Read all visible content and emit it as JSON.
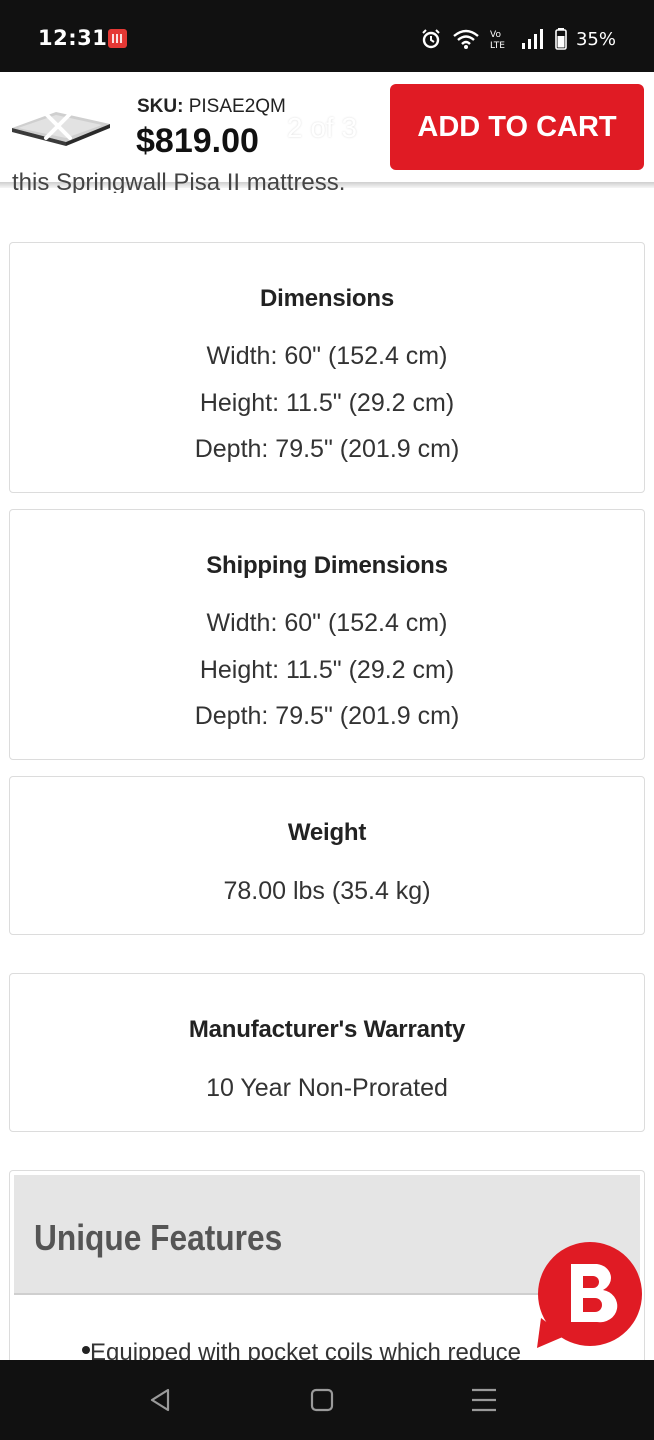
{
  "status_bar": {
    "time": "12:31",
    "battery": "35%",
    "icons": [
      "calendar-notification-icon",
      "alarm-icon",
      "wifi-icon",
      "volte-icon",
      "signal-icon",
      "battery-icon"
    ]
  },
  "sticky_header": {
    "sku_label": "SKU:",
    "sku_value": "PISAE2QM",
    "price": "$819.00",
    "pager": "2 of 3",
    "add_to_cart_label": "ADD TO CART",
    "accent_color": "#e01b24"
  },
  "partial_text": "this Springwall Pisa II mattress.",
  "specs": {
    "dimensions": {
      "title": "Dimensions",
      "lines": [
        "Width: 60\" (152.4 cm)",
        "Height: 11.5\" (29.2 cm)",
        "Depth: 79.5\" (201.9 cm)"
      ]
    },
    "shipping": {
      "title": "Shipping Dimensions",
      "lines": [
        "Width: 60\" (152.4 cm)",
        "Height: 11.5\" (29.2 cm)",
        "Depth: 79.5\" (201.9 cm)"
      ]
    },
    "weight": {
      "title": "Weight",
      "lines": [
        "78.00 lbs (35.4 kg)"
      ]
    },
    "warranty": {
      "title": "Manufacturer's Warranty",
      "lines": [
        "10 Year Non-Prorated"
      ]
    }
  },
  "features": {
    "title": "Unique Features",
    "items": [
      "Equipped with pocket coils which reduce"
    ]
  },
  "chat": {
    "icon": "brand-chat-icon",
    "color": "#e01b24"
  },
  "nav_bar": {
    "icons": [
      "back-icon",
      "home-icon",
      "recents-icon"
    ]
  }
}
